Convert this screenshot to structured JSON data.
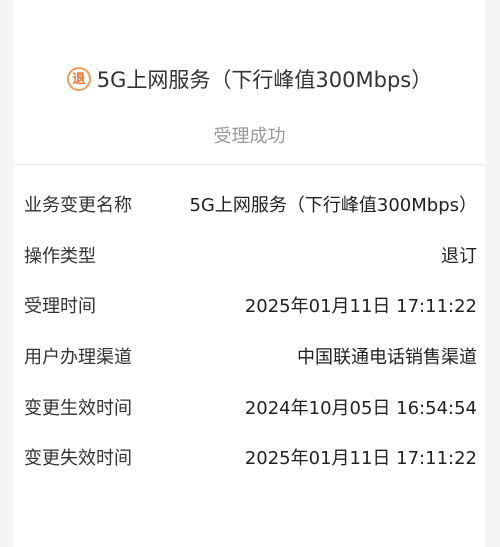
{
  "header": {
    "badge_char": "退",
    "title": "5G上网服务（下行峰值300Mbps）",
    "status": "受理成功"
  },
  "details": [
    {
      "label": "业务变更名称",
      "value": "5G上网服务（下行峰值300Mbps）"
    },
    {
      "label": "操作类型",
      "value": "退订"
    },
    {
      "label": "受理时间",
      "value": "2025年01月11日 17:11:22"
    },
    {
      "label": "用户办理渠道",
      "value": "中国联通电话销售渠道"
    },
    {
      "label": "变更生效时间",
      "value": "2024年10月05日 16:54:54"
    },
    {
      "label": "变更失效时间",
      "value": "2025年01月11日 17:11:22"
    }
  ],
  "colors": {
    "badge": "#e8732c",
    "status": "#999999"
  },
  "icons": {
    "badge": "unsubscribe-badge-icon"
  }
}
